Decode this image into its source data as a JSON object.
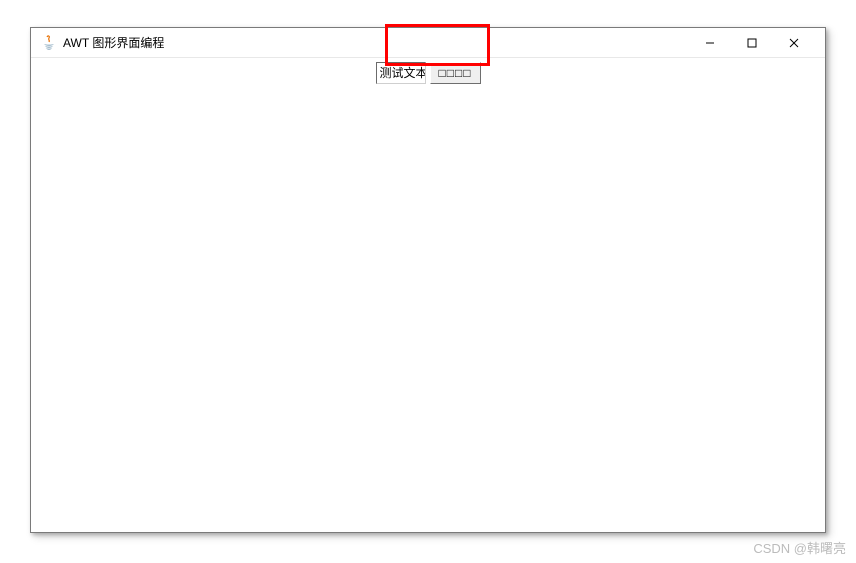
{
  "window": {
    "title": "AWT 图形界面编程"
  },
  "content": {
    "textfield_value": "测试文本",
    "button_label": "□□□□"
  },
  "annotation": {
    "highlight": true
  },
  "watermark": {
    "text": "CSDN @韩曙亮"
  }
}
